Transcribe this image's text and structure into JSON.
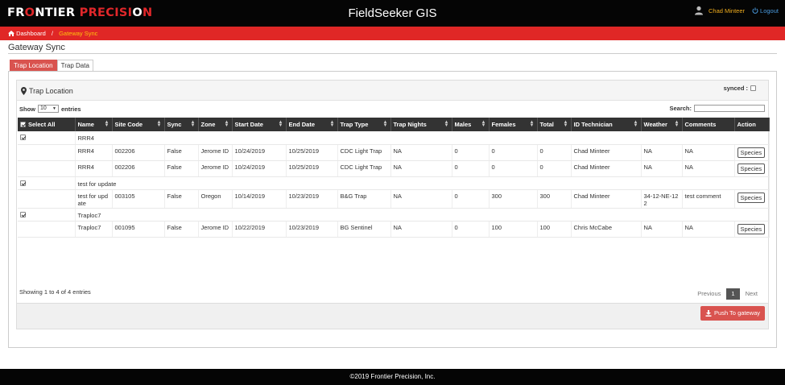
{
  "header": {
    "logo_left": "FR",
    "logo_o": "O",
    "logo_mid": "NTIER ",
    "logo_right": "PRECISI",
    "logo_o2": "O",
    "logo_end": "N",
    "app_title": "FieldSeeker GIS",
    "user_name": "Chad Minteer",
    "logout_label": "Logout",
    "accent_color": "#e02726"
  },
  "breadcrumb": {
    "home": "Dashboard",
    "separator": "/",
    "current": "Gateway Sync"
  },
  "page_title": "Gateway Sync",
  "tabs": [
    {
      "label": "Trap Location",
      "active": true
    },
    {
      "label": "Trap Data",
      "active": false
    }
  ],
  "panel": {
    "title": "Trap Location",
    "synced_label": "synced :",
    "show_label": "Show",
    "show_value": "10",
    "entries_label": "entries",
    "search_label": "Search:"
  },
  "table": {
    "columns": [
      "Select All",
      "Name",
      "Site Code",
      "Sync",
      "Zone",
      "Start Date",
      "End Date",
      "Trap Type",
      "Trap Nights",
      "Males",
      "Females",
      "Total",
      "ID Technician",
      "Weather",
      "Comments",
      "Action"
    ],
    "groups": [
      {
        "name": "RRR4",
        "rows": [
          [
            "RRR4",
            "002206",
            "False",
            "Jerome ID",
            "10/24/2019",
            "10/25/2019",
            "CDC Light Trap",
            "NA",
            "0",
            "0",
            "0",
            "Chad Minteer",
            "NA",
            "NA"
          ],
          [
            "RRR4",
            "002206",
            "False",
            "Jerome ID",
            "10/24/2019",
            "10/25/2019",
            "CDC Light Trap",
            "NA",
            "0",
            "0",
            "0",
            "Chad Minteer",
            "NA",
            "NA"
          ]
        ]
      },
      {
        "name": "test for update",
        "rows": [
          [
            "test for upd ate",
            "003105",
            "False",
            "Oregon",
            "10/14/2019",
            "10/23/2019",
            "B&G Trap",
            "NA",
            "0",
            "300",
            "300",
            "Chad Minteer",
            "34-12-NE-12 2",
            "test comment"
          ]
        ]
      },
      {
        "name": "Traploc7",
        "rows": [
          [
            "Traploc7",
            "001095",
            "False",
            "Jerome ID",
            "10/22/2019",
            "10/23/2019",
            "BG Sentinel",
            "NA",
            "0",
            "100",
            "100",
            "Chris McCabe",
            "NA",
            "NA"
          ]
        ]
      }
    ],
    "action_label": "Species"
  },
  "footer_info": "Showing 1 to 4 of 4 entries",
  "pager": {
    "previous": "Previous",
    "current": "1",
    "next": "Next"
  },
  "push_button": "Push To gateway",
  "copyright": "©2019 Frontier Precision, Inc."
}
